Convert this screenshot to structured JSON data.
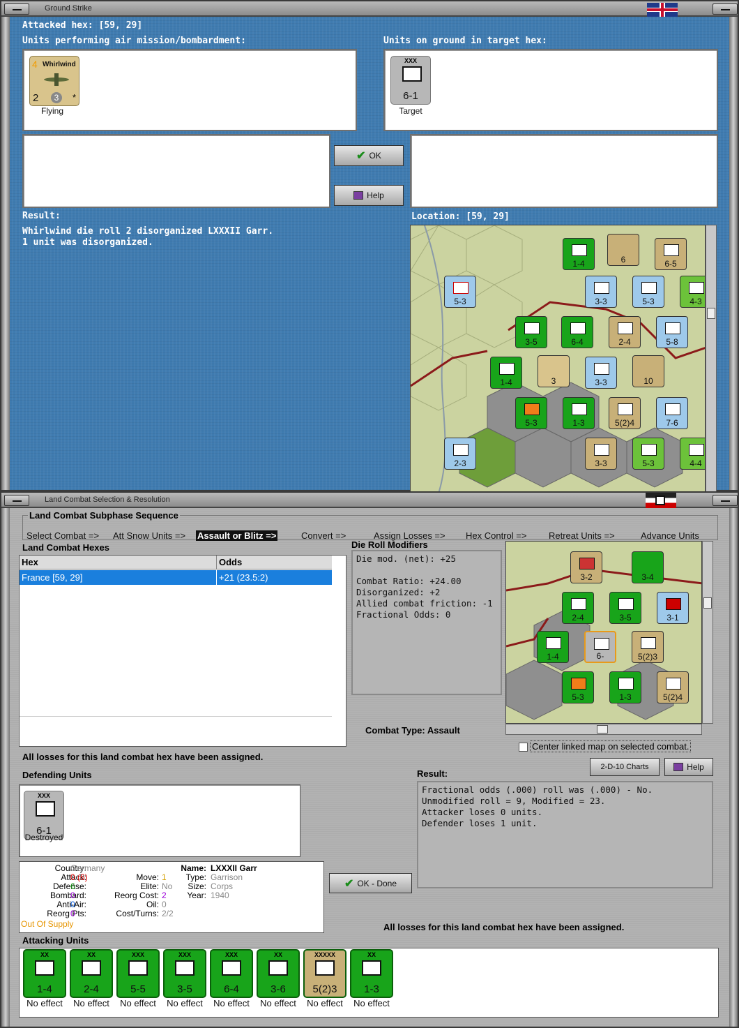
{
  "ground_strike": {
    "title": "Ground Strike",
    "attacked_hex": "Attacked hex:  [59, 29]",
    "air_units_label": "Units performing air mission/bombardment:",
    "ground_units_label": "Units on ground in target hex:",
    "air_unit": {
      "name": "Whirlwind",
      "top": "4",
      "bottom_left": "2",
      "bottom_mid": "3",
      "star": "*",
      "status": "Flying"
    },
    "ground_unit": {
      "name": "LXXXII Garr",
      "size": "XXX",
      "value": "6-1",
      "status": "Target"
    },
    "ok_label": "OK",
    "help_label": "Help",
    "result_label": "Result:",
    "result_lines": [
      "Whirlwind die roll 2 disorganized LXXXII Garr.",
      "1 unit was disorganized."
    ],
    "location_label": "Location:  [59, 29]"
  },
  "land_combat": {
    "title": "Land Combat Selection & Resolution",
    "seq_label": "Land Combat Subphase Sequence",
    "sequence": [
      "Select Combat =>",
      "Att Snow Units =>",
      "Assault or Blitz =>",
      "Convert =>",
      "Assign Losses =>",
      "Hex Control =>",
      "Retreat Units =>",
      "Advance Units"
    ],
    "hexes_label": "Land Combat Hexes",
    "col_hex": "Hex",
    "col_odds": "Odds",
    "row_hex": "France [59, 29]",
    "row_odds": "+21 (23.5:2)",
    "drm_label": "Die Roll Modifiers",
    "drm_lines": [
      "Die mod. (net): +25",
      "",
      "Combat Ratio: +24.00",
      "Disorganized: +2",
      "Allied combat friction: -1",
      "Fractional Odds: 0"
    ],
    "combat_type": "Combat Type:  Assault",
    "losses_msg": "All losses for this land combat hex have been assigned.",
    "center_label": "Center linked map on selected combat.",
    "charts_label": "2-D-10 Charts",
    "help_label": "Help",
    "defending_label": "Defending Units",
    "def_unit": {
      "name": "LXXXII Garr",
      "size": "XXX",
      "value": "6-1",
      "status": "Destroyed"
    },
    "result_label": "Result:",
    "result_lines": [
      "Fractional odds (.000) roll was (.000)  - No.",
      "Unmodified roll = 9, Modified = 23.",
      "Attacker loses 0 units.",
      "Defender loses 1 unit."
    ],
    "ok_done_label": "OK - Done",
    "losses_msg2": "All losses for this land combat hex have been assigned.",
    "attacking_label": "Attacking Units",
    "unit_info": {
      "country_k": "Country:",
      "country_v": "Germany",
      "attack_k": "Attack:",
      "attack_v": "0",
      "attack_v2": "(6)",
      "defense_k": "Defense:",
      "defense_v": "6",
      "bombard_k": "Bombard:",
      "bombard_v": "0",
      "antiair_k": "Anti-Air:",
      "antiair_v": "0",
      "reorg_k": "Reorg Pts:",
      "reorg_v": "0",
      "supply": "Out Of Supply",
      "move_k": "Move:",
      "move_v": "1",
      "elite_k": "Elite:",
      "elite_v": "No",
      "reorgcost_k": "Reorg Cost:",
      "reorgcost_v": "2",
      "oil_k": "Oil:",
      "oil_v": "0",
      "costturns_k": "Cost/Turns:",
      "costturns_v": "2/2",
      "name_k": "Name:",
      "name_v": "LXXXII Garr",
      "type_k": "Type:",
      "type_v": "Garrison",
      "size_k": "Size:",
      "size_v": "Corps",
      "year_k": "Year:",
      "year_v": "1940"
    },
    "attackers": [
      {
        "size": "XX",
        "value": "1-4",
        "status": "No effect",
        "color": "#18a41a"
      },
      {
        "size": "XX",
        "value": "2-4",
        "status": "No effect",
        "color": "#18a41a"
      },
      {
        "size": "XXX",
        "value": "5-5",
        "status": "No effect",
        "color": "#18a41a"
      },
      {
        "size": "XXX",
        "value": "3-5",
        "status": "No effect",
        "color": "#18a41a"
      },
      {
        "size": "XXX",
        "value": "6-4",
        "status": "No effect",
        "color": "#18a41a"
      },
      {
        "size": "XX",
        "value": "3-6",
        "status": "No effect",
        "color": "#18a41a"
      },
      {
        "size": "XXXXX",
        "value": "5(2)3",
        "status": "No effect",
        "color": "#c8b078"
      },
      {
        "size": "XX",
        "value": "1-3",
        "status": "No effect",
        "color": "#18a41a"
      }
    ]
  }
}
